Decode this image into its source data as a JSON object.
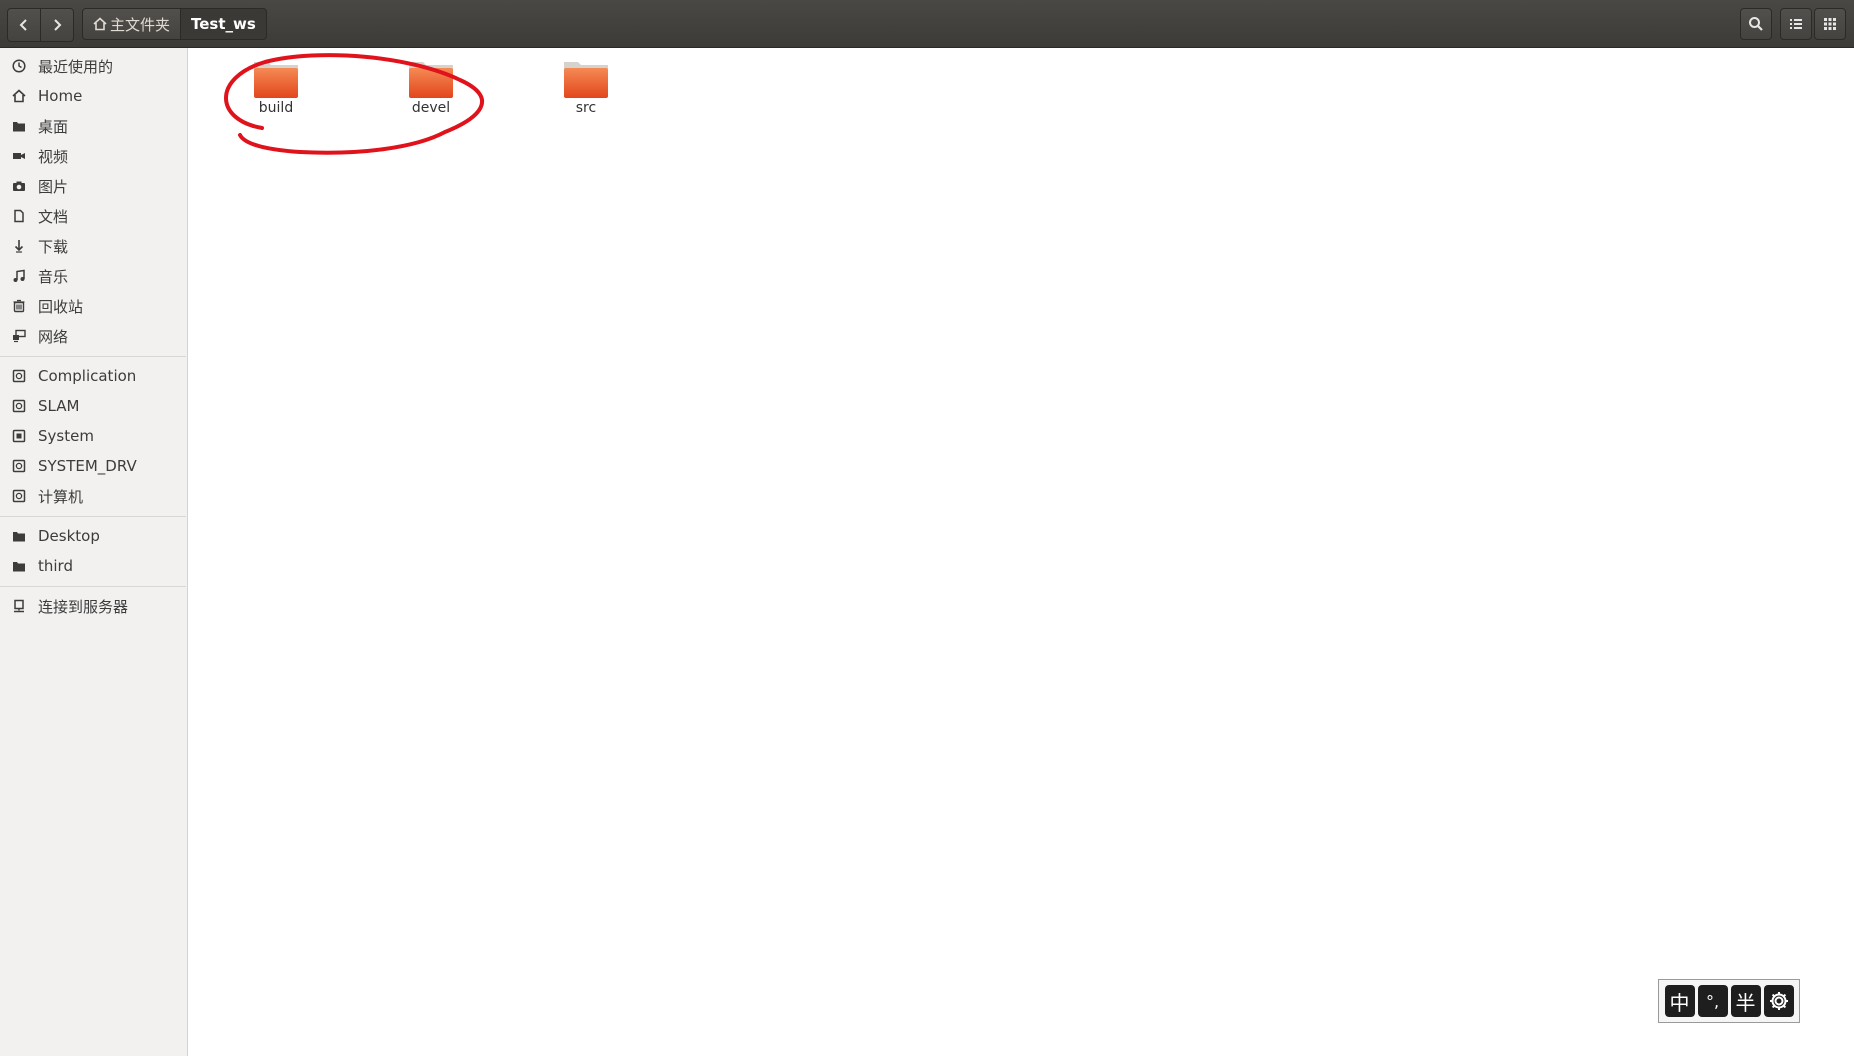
{
  "header": {
    "back_icon": "chevron-left-icon",
    "forward_icon": "chevron-right-icon",
    "breadcrumbs": [
      {
        "label": "主文件夹",
        "icon": "home-icon"
      },
      {
        "label": "Test_ws"
      }
    ],
    "search_icon": "search-icon",
    "list_view_icon": "list-view-icon",
    "grid_view_icon": "grid-view-icon"
  },
  "sidebar": {
    "places": [
      {
        "label": "最近使用的",
        "icon": "clock-icon"
      },
      {
        "label": "Home",
        "icon": "home-icon"
      },
      {
        "label": "桌面",
        "icon": "folder-icon"
      },
      {
        "label": "视频",
        "icon": "video-icon"
      },
      {
        "label": "图片",
        "icon": "camera-icon"
      },
      {
        "label": "文档",
        "icon": "document-icon"
      },
      {
        "label": "下载",
        "icon": "download-icon"
      },
      {
        "label": "音乐",
        "icon": "music-icon"
      },
      {
        "label": "回收站",
        "icon": "trash-icon"
      },
      {
        "label": "网络",
        "icon": "network-icon"
      }
    ],
    "devices": [
      {
        "label": "Complication",
        "icon": "drive-icon"
      },
      {
        "label": "SLAM",
        "icon": "drive-icon"
      },
      {
        "label": "System",
        "icon": "drive-icon"
      },
      {
        "label": "SYSTEM_DRV",
        "icon": "drive-icon"
      },
      {
        "label": "计算机",
        "icon": "drive-icon"
      }
    ],
    "bookmarks": [
      {
        "label": "Desktop",
        "icon": "folder-icon"
      },
      {
        "label": "third",
        "icon": "folder-icon"
      }
    ],
    "other": [
      {
        "label": "连接到服务器",
        "icon": "server-icon"
      }
    ]
  },
  "files": [
    {
      "name": "build",
      "type": "folder"
    },
    {
      "name": "devel",
      "type": "folder"
    },
    {
      "name": "src",
      "type": "folder"
    }
  ],
  "ime": {
    "keys": [
      "中",
      "°,",
      "半"
    ],
    "settings_icon": "gear-icon"
  },
  "colors": {
    "folder_orange": "#f0652f",
    "annotation_red": "#e0121b",
    "headerbar": "#3c3b37"
  }
}
